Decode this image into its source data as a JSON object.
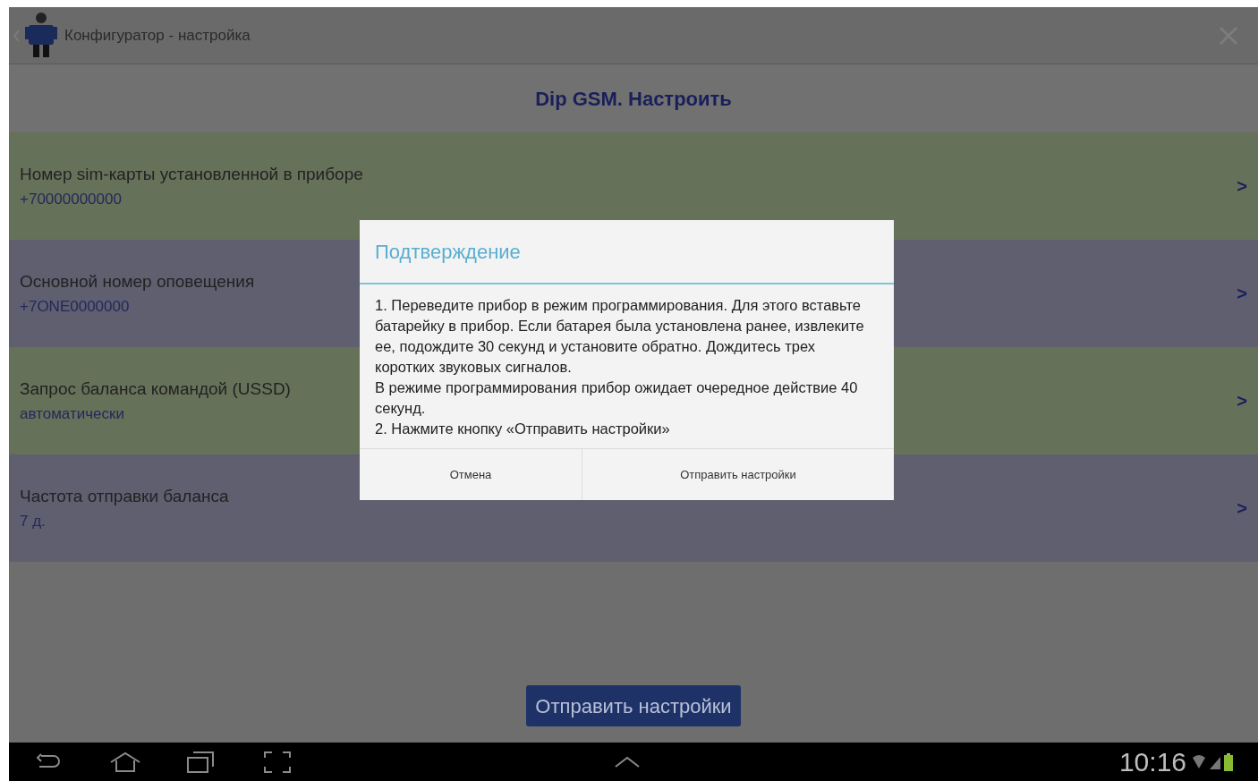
{
  "app_bar": {
    "title": "Конфигуратор - настройка"
  },
  "header": {
    "title": "Dip GSM. Настроить"
  },
  "settings": [
    {
      "label": "Номер sim-карты установленной в приборе",
      "value": "+70000000000",
      "arrow": ">",
      "color": "#66715a"
    },
    {
      "label": "Основной номер оповещения",
      "value": "+7ONE0000000",
      "arrow": ">",
      "color": "#5f5f70"
    },
    {
      "label": "Запрос баланса командой (USSD)",
      "value": "автоматически",
      "arrow": ">",
      "color": "#66715a"
    },
    {
      "label": "Частота отправки баланса",
      "value": "7 д.",
      "arrow": ">",
      "color": "#5f5f70"
    }
  ],
  "send_button": "Отправить настройки",
  "dialog": {
    "title": "Подтверждение",
    "lines": [
      "1. Переведите прибор в режим программирования. Для этого вставьте батарейку в прибор. Если батарея была установлена ранее, извлеките ее, подождите 30 секунд и установите обратно. Дождитесь трех коротких звуковых сигналов.",
      "В режиме программирования прибор ожидает очередное действие 40 секунд.",
      "2. Нажмите кнопку «Отправить настройки»"
    ],
    "buttons": [
      "Отмена",
      "Отправить настройки"
    ]
  },
  "status_bar": {
    "time": "10:16"
  }
}
